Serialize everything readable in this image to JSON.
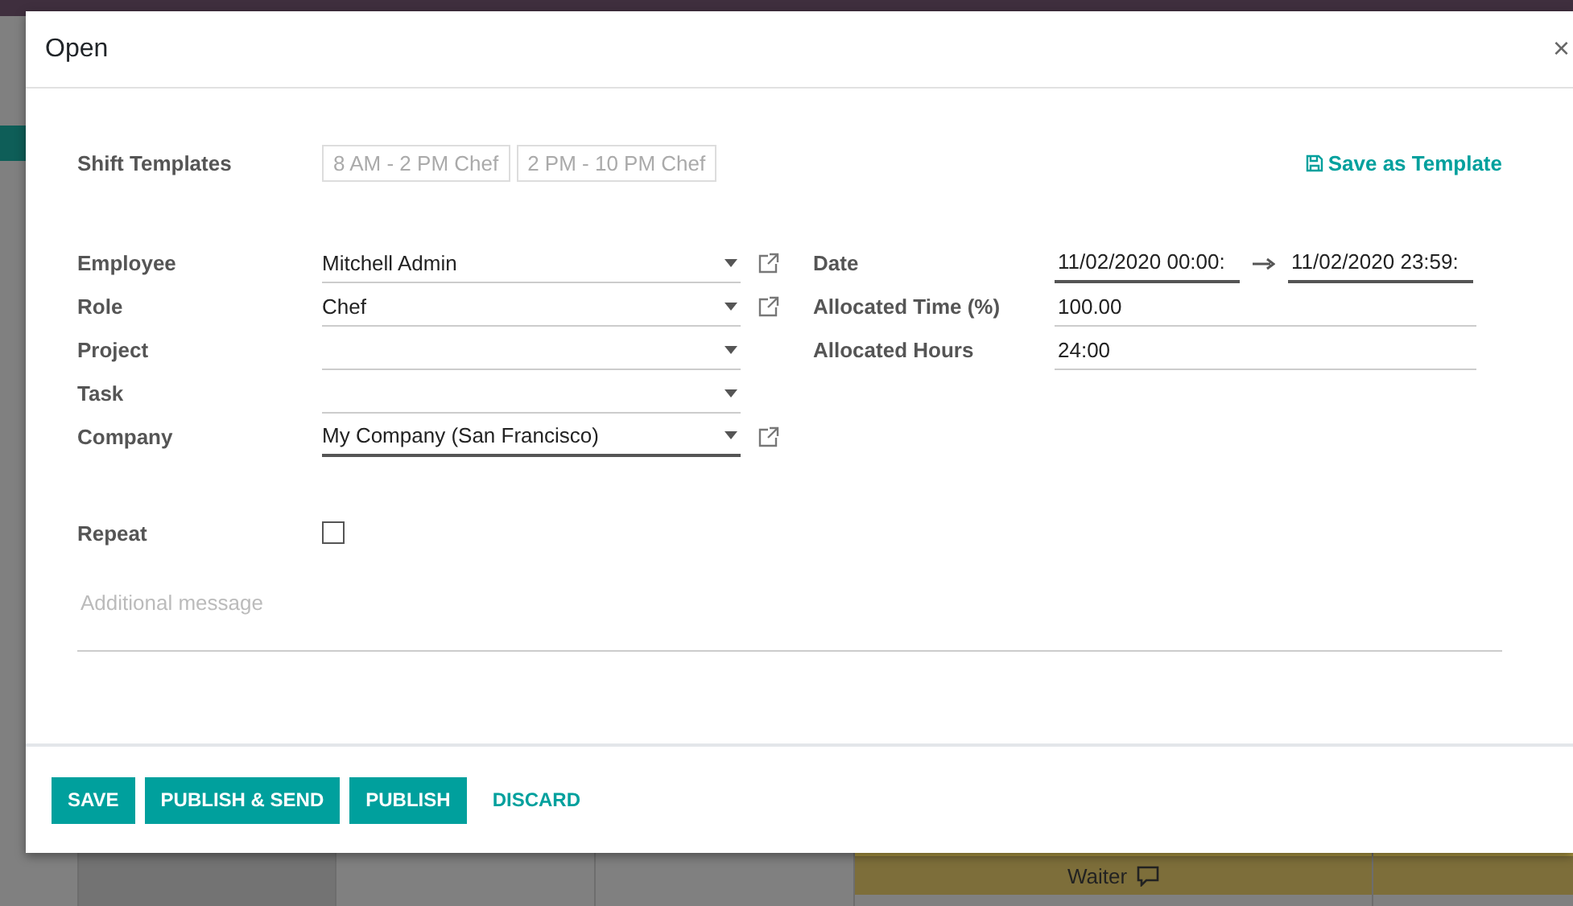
{
  "background": {
    "shift_label": "Waiter"
  },
  "dialog": {
    "title": "Open",
    "close": "×",
    "shift_templates": {
      "label": "Shift Templates",
      "items": [
        "8 AM - 2 PM Chef",
        "2 PM - 10 PM Chef"
      ]
    },
    "save_template": "Save as Template",
    "left_fields": [
      {
        "label": "Employee",
        "value": "Mitchell Admin",
        "required": false,
        "link": true
      },
      {
        "label": "Role",
        "value": "Chef",
        "required": false,
        "link": true
      },
      {
        "label": "Project",
        "required": false,
        "link": false
      },
      {
        "label": "Task",
        "required": false,
        "link": false
      },
      {
        "label": "Company",
        "value": "My Company (San Francisco)",
        "required": true,
        "link": true
      }
    ],
    "date": {
      "label": "Date",
      "start": "11/02/2020 00:00:",
      "end": "11/02/2020 23:59:"
    },
    "right_fields": [
      {
        "label": "Allocated Time (%)",
        "value": "100.00"
      },
      {
        "label": "Allocated Hours",
        "value": "24:00"
      }
    ],
    "repeat": {
      "label": "Repeat",
      "checked": false
    },
    "message": {
      "placeholder": "Additional message"
    },
    "buttons": [
      {
        "label": "SAVE",
        "kind": "primary"
      },
      {
        "label": "PUBLISH & SEND",
        "kind": "primary"
      },
      {
        "label": "PUBLISH",
        "kind": "primary"
      },
      {
        "label": "DISCARD",
        "kind": "link"
      }
    ]
  }
}
